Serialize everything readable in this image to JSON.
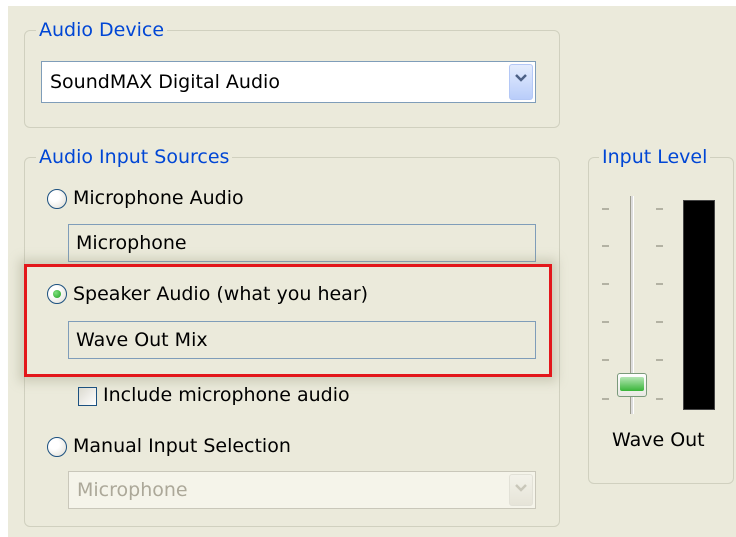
{
  "audio_device": {
    "legend": "Audio Device",
    "selected": "SoundMAX Digital Audio"
  },
  "input_sources": {
    "legend": "Audio Input Sources",
    "microphone": {
      "label": "Microphone Audio",
      "value": "Microphone",
      "selected": false
    },
    "speaker": {
      "label": "Speaker Audio (what you hear)",
      "value": "Wave Out Mix",
      "selected": true
    },
    "include_mic": {
      "label": "Include microphone audio",
      "checked": false
    },
    "manual": {
      "label": "Manual Input Selection",
      "selected": false,
      "dropdown_value": "Microphone",
      "enabled": false
    }
  },
  "input_level": {
    "legend": "Input Level",
    "source_label": "Wave Out",
    "slider_level": 0.08,
    "meter_level": 0
  },
  "colors": {
    "accent": "#0046d5",
    "highlight": "#e3171b",
    "panel_bg": "#ebeadb"
  }
}
